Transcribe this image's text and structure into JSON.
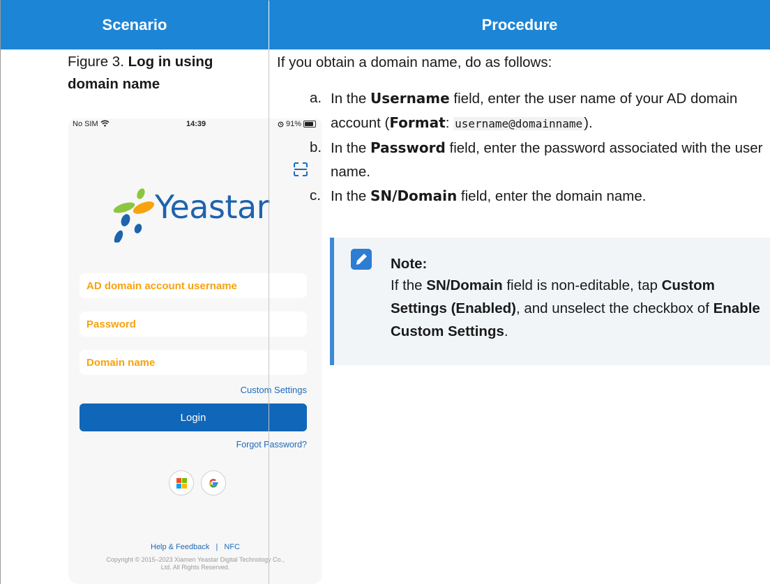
{
  "header": {
    "scenario": "Scenario",
    "procedure": "Procedure"
  },
  "figure": {
    "prefix": "Figure 3. ",
    "title": "Log in using domain name"
  },
  "phone": {
    "status": {
      "carrier": "No SIM",
      "time": "14:39",
      "battery": "91%"
    },
    "logo_text": "Yeastar",
    "fields": {
      "username": "AD domain account username",
      "password": "Password",
      "domain": "Domain name"
    },
    "custom_settings": "Custom Settings",
    "login": "Login",
    "forgot": "Forgot Password?",
    "help": "Help & Feedback",
    "separator": "|",
    "nfc": "NFC",
    "copyright_line1": "Copyright © 2015–2023 Xiamen Yeastar Digital Technology Co.,",
    "copyright_line2": "Ltd. All Rights Reserved."
  },
  "procedure": {
    "intro": "If you obtain a domain name, do as follows:",
    "steps": [
      {
        "label": "a.",
        "pre": "In the ",
        "bold": "Username",
        "post": " field, enter the user name of your AD domain account (",
        "fmt_label": "Format",
        "fmt_sep": ": ",
        "code": "username@domainname",
        "end": ")."
      },
      {
        "label": "b.",
        "pre": "In the ",
        "bold": "Password",
        "post": " field, enter the password associated with the user name."
      },
      {
        "label": "c.",
        "pre": "In the ",
        "bold": "SN/Domain",
        "post": " field, enter the domain name."
      }
    ],
    "note": {
      "title": "Note:",
      "t1": "If the ",
      "b1": "SN/Domain",
      "t2": " field is non-editable, tap ",
      "b2": "Custom Settings (Enabled)",
      "t3": ", and unselect the checkbox of ",
      "b3": "Enable Custom Settings",
      "t4": "."
    }
  },
  "colors": {
    "header_bg": "#1d85d6",
    "accent_orange": "#f5a30f",
    "brand_blue": "#1066b8",
    "note_border": "#3a8ad9"
  },
  "icons": [
    "wifi-icon",
    "alarm-icon",
    "battery-icon",
    "scan-icon",
    "yeastar-logo",
    "microsoft-icon",
    "google-icon",
    "edit-note-icon"
  ]
}
